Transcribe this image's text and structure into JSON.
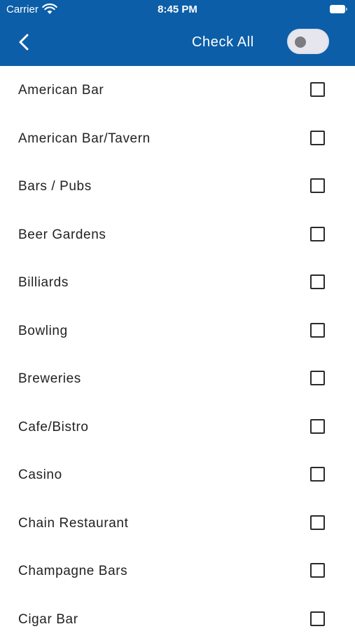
{
  "status_bar": {
    "carrier": "Carrier",
    "time": "8:45 PM"
  },
  "nav": {
    "back_icon": "chevron-left-icon",
    "check_all_label": "Check All",
    "check_all_on": false
  },
  "categories": [
    {
      "label": "American Bar",
      "checked": false
    },
    {
      "label": "American Bar/Tavern",
      "checked": false
    },
    {
      "label": "Bars / Pubs",
      "checked": false
    },
    {
      "label": "Beer Gardens",
      "checked": false
    },
    {
      "label": "Billiards",
      "checked": false
    },
    {
      "label": "Bowling",
      "checked": false
    },
    {
      "label": "Breweries",
      "checked": false
    },
    {
      "label": "Cafe/Bistro",
      "checked": false
    },
    {
      "label": "Casino",
      "checked": false
    },
    {
      "label": "Chain Restaurant",
      "checked": false
    },
    {
      "label": "Champagne Bars",
      "checked": false
    },
    {
      "label": "Cigar Bar",
      "checked": false
    }
  ],
  "colors": {
    "header_bg": "#0c5ea8",
    "text": "#222222"
  }
}
